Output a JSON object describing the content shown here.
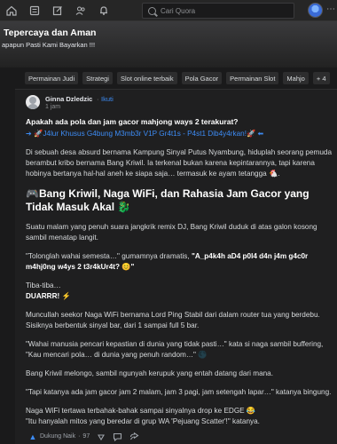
{
  "nav": {
    "icons": [
      "home-icon",
      "list-icon",
      "edit-icon",
      "people-icon",
      "bell-icon"
    ],
    "search_placeholder": "Cari Quora"
  },
  "banner": {
    "title": "Tepercaya dan Aman",
    "subtitle": "apapun Pasti Kami Bayarkan !!!"
  },
  "chips": [
    "Permainan Judi",
    "Strategi",
    "Slot online terbaik",
    "Pola Gacor",
    "Permainan Slot",
    "Mahjo"
  ],
  "chips_more": "+ 4",
  "post": {
    "author": "Ginna Dzledzic",
    "sep": "·",
    "follow": "Ikuti",
    "time": "1 jam",
    "question": "Apakah ada pola dan jam gacor mahjong ways 2 terakurat?",
    "link": "➔ 🚀J4lur Khusus G4bung M3mb3r V1P Gr4t1s - P4st1 Dib4y4rkan!🚀 ⬅",
    "intro": "Di sebuah desa absurd bernama Kampung Sinyal Putus Nyambung, hiduplah seorang pemuda berambut kribo bernama Bang Kriwil. Ia terkenal bukan karena kepintarannya, tapi karena hobinya bertanya hal-hal aneh ke siapa saja… termasuk ke ayam tetangga 🐔.",
    "heading": "🎮Bang Kriwil, Naga WiFi, dan Rahasia Jam Gacor yang Tidak Masuk Akal 🐉",
    "p1": "Suatu malam yang penuh suara jangkrik remix DJ, Bang Kriwil duduk di atas galon kosong sambil menatap langit.",
    "p2_a": "\"Tolonglah wahai semesta…\" gumamnya dramatis, ",
    "p2_b": "\"A_p4k4h aD4 p0l4 d4n j4m g4c0r m4hj0ng w4ys 2 t3r4kUr4t? 😊\"",
    "p3_a": "Tiba-tiba…",
    "p3_b": "DUARRR! ⚡",
    "p4": "Muncullah seekor Naga WiFi bernama Lord Ping Stabil dari dalam router tua yang berdebu. Sisiknya berbentuk sinyal bar, dari 1 sampai full 5 bar.",
    "p5": "\"Wahai manusia pencari kepastian di dunia yang tidak pasti…\" kata si naga sambil buffering, \"Kau mencari pola… di dunia yang penuh random…\" 🌑",
    "p6": "Bang Kriwil melongo, sambil ngunyah kerupuk yang entah datang dari mana.",
    "p7": "\"Tapi katanya ada jam gacor jam 2 malam, jam 3 pagi, jam setengah lapar…\" katanya bingung.",
    "p8": "Naga WiFi tertawa terbahak-bahak sampai sinyalnya drop ke EDGE 😂",
    "p9": "\"Itu hanyalah mitos yang beredar di grup WA 'Pejuang Scatter'!\" katanya."
  },
  "actions": {
    "upvote_label": "Dukung Naik",
    "upvote_sep": "·",
    "upvote_count": "97"
  },
  "colors": {
    "accent": "#3d8cf5",
    "background": "#1a1a1b",
    "card": "#1f1f20"
  }
}
